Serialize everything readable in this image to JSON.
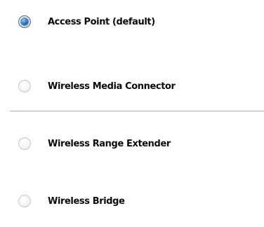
{
  "mode_options": [
    {
      "label": "Access Point (default)",
      "checked": true
    },
    {
      "label": "Wireless Media Connector",
      "checked": false
    },
    {
      "label": "Wireless Range Extender",
      "checked": false
    },
    {
      "label": "Wireless Bridge",
      "checked": false
    }
  ],
  "colors": {
    "divider": "#a8a7cf",
    "radio_selected": "#2f7fd4",
    "label_text": "#0a0a0a"
  }
}
